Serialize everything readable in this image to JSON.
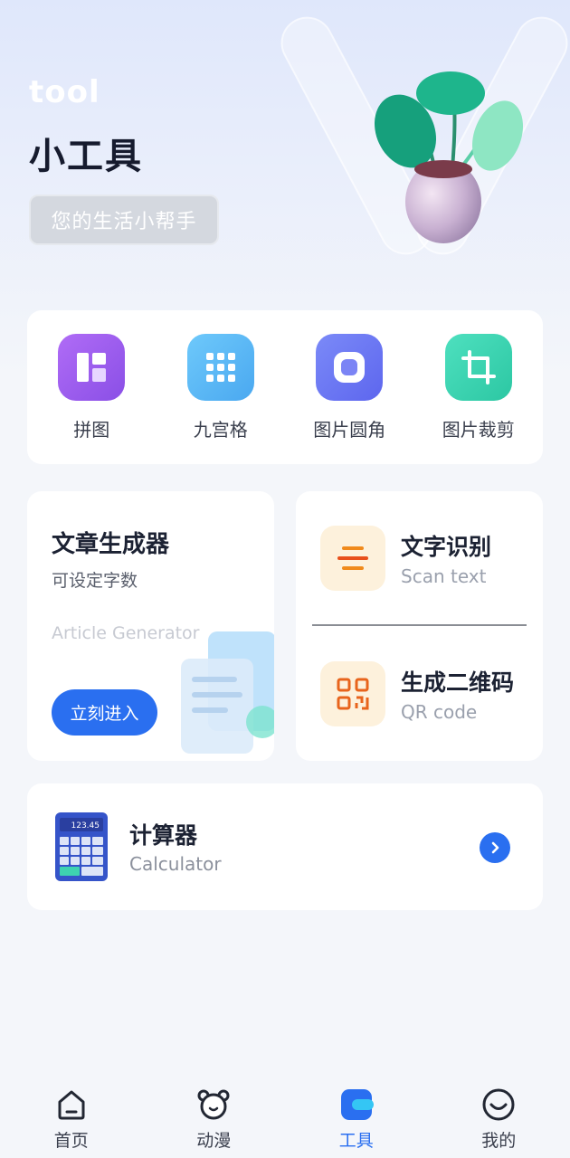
{
  "hero": {
    "tag": "tool",
    "title": "小工具",
    "subtitle": "您的生活小帮手"
  },
  "quick_tools": [
    {
      "label": "拼图",
      "icon": "puzzle-layout-icon",
      "color": "#9b5cf0"
    },
    {
      "label": "九宫格",
      "icon": "grid-nine-icon",
      "color": "#5fb8f5"
    },
    {
      "label": "图片圆角",
      "icon": "rounded-corner-icon",
      "color": "#6f7cf5"
    },
    {
      "label": "图片裁剪",
      "icon": "crop-icon",
      "color": "#3ed2b0"
    }
  ],
  "article": {
    "title": "文章生成器",
    "subtitle": "可设定字数",
    "english": "Article Generator",
    "button": "立刻进入"
  },
  "ocr": {
    "title": "文字识别",
    "subtitle": "Scan text"
  },
  "qr": {
    "title": "生成二维码",
    "subtitle": "QR code"
  },
  "calculator": {
    "title": "计算器",
    "subtitle": "Calculator",
    "display": "123.45"
  },
  "tabbar": [
    {
      "label": "首页",
      "icon": "home-icon",
      "active": false
    },
    {
      "label": "动漫",
      "icon": "bear-face-icon",
      "active": false
    },
    {
      "label": "工具",
      "icon": "tool-icon",
      "active": true
    },
    {
      "label": "我的",
      "icon": "smile-profile-icon",
      "active": false
    }
  ],
  "colors": {
    "accent": "#2a6ff0",
    "card": "#ffffff",
    "background": "#f4f6fa",
    "icon_orange": "#f08a1c"
  }
}
